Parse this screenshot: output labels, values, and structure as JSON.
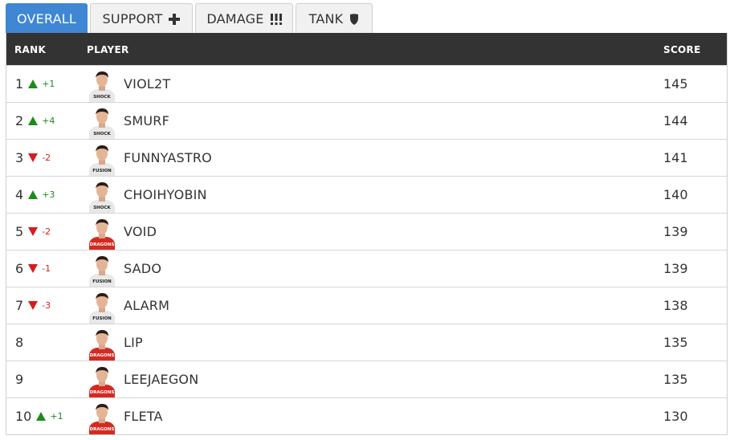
{
  "tabs": [
    {
      "label": "OVERALL",
      "icon": "",
      "active": true
    },
    {
      "label": "SUPPORT",
      "icon": "plus-icon",
      "active": false
    },
    {
      "label": "DAMAGE",
      "icon": "exclamations-icon",
      "active": false
    },
    {
      "label": "TANK",
      "icon": "shield-icon",
      "active": false
    }
  ],
  "table": {
    "headers": {
      "rank": "RANK",
      "player": "PLAYER",
      "score": "SCORE"
    },
    "rows": [
      {
        "rank": "1",
        "trend": "up",
        "change": "+1",
        "player": "VIOL2T",
        "score": "145",
        "jersey": "white",
        "team_text": "SHOCK"
      },
      {
        "rank": "2",
        "trend": "up",
        "change": "+4",
        "player": "SMURF",
        "score": "144",
        "jersey": "white",
        "team_text": "SHOCK"
      },
      {
        "rank": "3",
        "trend": "down",
        "change": "-2",
        "player": "FUNNYASTRO",
        "score": "141",
        "jersey": "white",
        "team_text": "FUSION"
      },
      {
        "rank": "4",
        "trend": "up",
        "change": "+3",
        "player": "CHOIHYOBIN",
        "score": "140",
        "jersey": "white",
        "team_text": "SHOCK"
      },
      {
        "rank": "5",
        "trend": "down",
        "change": "-2",
        "player": "VOID",
        "score": "139",
        "jersey": "red",
        "team_text": "DRAGONS"
      },
      {
        "rank": "6",
        "trend": "down",
        "change": "-1",
        "player": "SADO",
        "score": "139",
        "jersey": "white",
        "team_text": "FUSION"
      },
      {
        "rank": "7",
        "trend": "down",
        "change": "-3",
        "player": "ALARM",
        "score": "138",
        "jersey": "white",
        "team_text": "FUSION"
      },
      {
        "rank": "8",
        "trend": "none",
        "change": "",
        "player": "LIP",
        "score": "135",
        "jersey": "red",
        "team_text": "DRAGONS"
      },
      {
        "rank": "9",
        "trend": "none",
        "change": "",
        "player": "LEEJAEGON",
        "score": "135",
        "jersey": "red",
        "team_text": "DRAGONS"
      },
      {
        "rank": "10",
        "trend": "up",
        "change": "+1",
        "player": "FLETA",
        "score": "130",
        "jersey": "red",
        "team_text": "DRAGONS"
      }
    ]
  },
  "colors": {
    "accent": "#3f86d4",
    "header_bg": "#333333",
    "up": "#1e8a1e",
    "down": "#d41d1d",
    "jersey_red": "#d42a22",
    "jersey_white": "#e8e8e8"
  }
}
